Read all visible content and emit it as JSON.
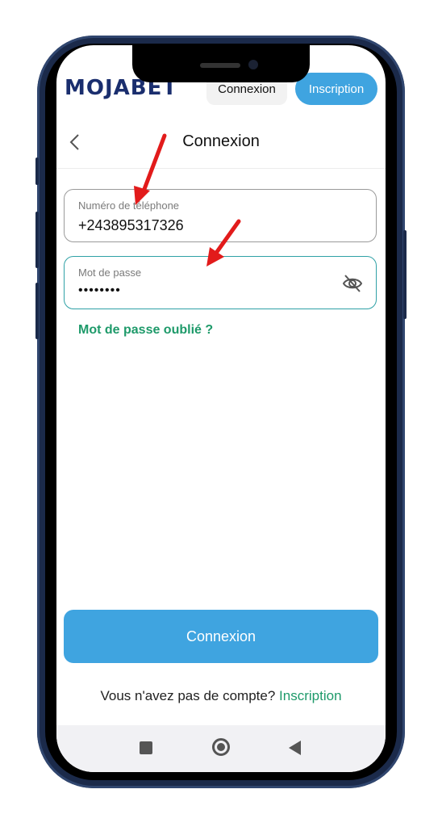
{
  "header": {
    "logo": "MOJABET",
    "connexion_label": "Connexion",
    "inscription_label": "Inscription"
  },
  "page": {
    "title": "Connexion"
  },
  "form": {
    "phone": {
      "label": "Numéro de téléphone",
      "value": "+243895317326"
    },
    "password": {
      "label": "Mot de passe",
      "value": "••••••••"
    },
    "forgot_label": "Mot de passe oublié ?",
    "submit_label": "Connexion"
  },
  "footer": {
    "prompt": "Vous n'avez pas de compte?",
    "link": "Inscription"
  },
  "colors": {
    "accent_blue": "#3fa4e0",
    "link_green": "#1e9a6a",
    "annotation_red": "#e21b1b",
    "logo_navy": "#1a2e6e",
    "frame": "#1b2a4a"
  },
  "icons": [
    "chevron-left-icon",
    "eye-off-icon",
    "nav-recents-icon",
    "nav-home-icon",
    "nav-back-icon"
  ]
}
